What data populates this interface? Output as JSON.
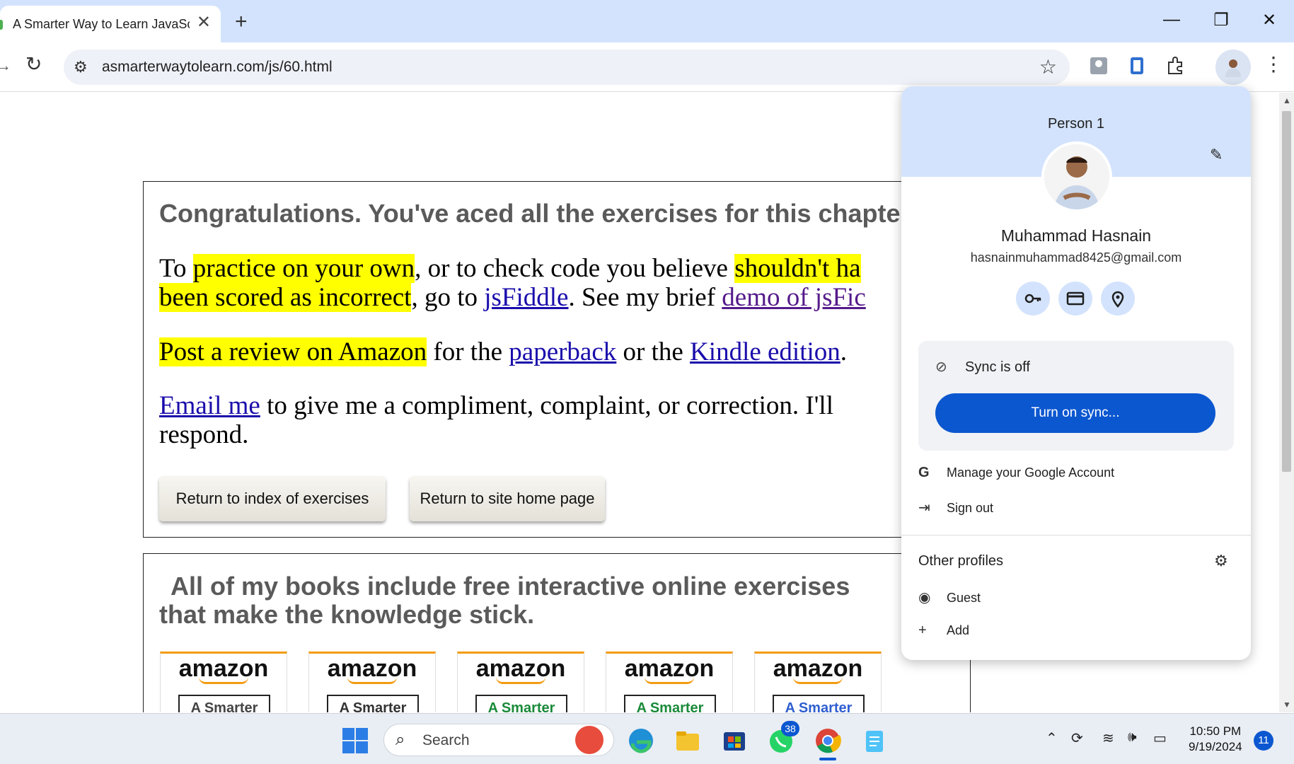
{
  "browser": {
    "tab_title": "A Smarter Way to Learn JavaScr",
    "url": "asmarterwaytolearn.com/js/60.html"
  },
  "content": {
    "congrats": "Congratulations. You've aced all the exercises for this chapter.",
    "p1_a": "To ",
    "p1_hl1": "practice on your own",
    "p1_b": ", or to check code you believe ",
    "p1_hl2": "shouldn't ha",
    "p1_hl3": "been scored as incorrect",
    "p1_c": ", go to ",
    "p1_link1": "jsFiddle",
    "p1_d": ". See my brief ",
    "p1_link2": "demo of jsFic",
    "p2_hl": "Post a review on Amazon",
    "p2_a": " for the ",
    "p2_link1": "paperback",
    "p2_b": " or the ",
    "p2_link2": "Kindle edition",
    "p2_c": ".",
    "p3_link": "Email me",
    "p3_a": " to give me a compliment, complaint, or correction. I'll respond.",
    "btn_index": "Return to index of exercises",
    "btn_home": "Return to site home page",
    "books_heading": "All of my books include free interactive online exercises that make the knowledge stick.",
    "books": [
      {
        "brand": "amazon",
        "label": "A Smarter",
        "color": "#333333"
      },
      {
        "brand": "amazon",
        "label": "A Smarter",
        "color": "#333333"
      },
      {
        "brand": "amazon",
        "label": "A Smarter",
        "color": "#1a8a3a"
      },
      {
        "brand": "amazon",
        "label": "A Smarter",
        "color": "#1a8a3a"
      },
      {
        "brand": "amazon",
        "label": "A Smarter",
        "color": "#2f5fd0"
      }
    ]
  },
  "profile": {
    "person": "Person 1",
    "name": "Muhammad Hasnain",
    "email": "hasnainmuhammad8425@gmail.com",
    "sync_status": "Sync is off",
    "sync_button": "Turn on sync...",
    "manage_account": "Manage your Google Account",
    "sign_out": "Sign out",
    "other_profiles": "Other profiles",
    "guest": "Guest",
    "add": "Add"
  },
  "taskbar": {
    "search_placeholder": "Search",
    "whatsapp_badge": "38",
    "time": "10:50 PM",
    "date": "9/19/2024",
    "notifications": "11"
  },
  "colors": {
    "accent": "#0b57d0",
    "highlight": "#ffff00",
    "tabstrip": "#d3e3fd"
  }
}
